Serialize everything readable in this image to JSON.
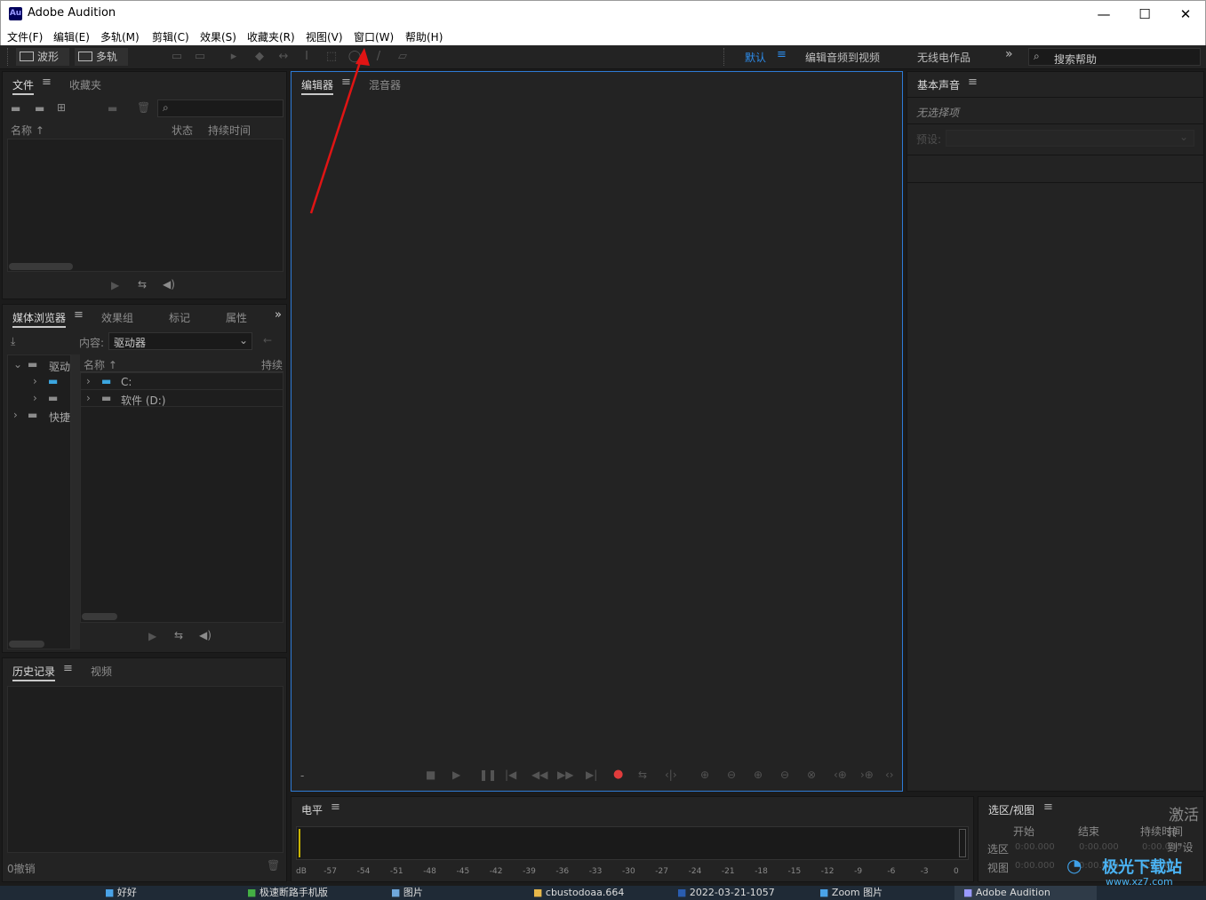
{
  "window": {
    "app_title": "Adobe Audition",
    "logo_text": "Au",
    "minimize": "—",
    "maximize": "☐",
    "close": "✕"
  },
  "menu": [
    {
      "label": "文件(F)"
    },
    {
      "label": "编辑(E)"
    },
    {
      "label": "多轨(M)"
    },
    {
      "label": "剪辑(C)"
    },
    {
      "label": "效果(S)"
    },
    {
      "label": "收藏夹(R)"
    },
    {
      "label": "视图(V)"
    },
    {
      "label": "窗口(W)"
    },
    {
      "label": "帮助(H)"
    }
  ],
  "toolbar": {
    "waveform_label": "波形",
    "multitrack_label": "多轨",
    "workspaces": [
      "默认",
      "编辑音频到视频",
      "无线电作品"
    ],
    "overflow": "»",
    "search_placeholder": "搜索帮助",
    "active_workspace_color": "#2d8ceb"
  },
  "files_panel": {
    "tabs": [
      "文件",
      "收藏夹"
    ],
    "columns": [
      "名称",
      "状态",
      "持续时间"
    ]
  },
  "media_browser": {
    "tabs": [
      "媒体浏览器",
      "效果组",
      "标记",
      "属性"
    ],
    "content_label": "内容:",
    "content_value": "驱动器",
    "tree": [
      {
        "label": "驱动"
      },
      {
        "label": "快捷"
      }
    ],
    "tree_col_header": "名称",
    "col_duration": "持续",
    "items": [
      {
        "label": "C:"
      },
      {
        "label": "软件 (D:)"
      }
    ]
  },
  "history_panel": {
    "tabs": [
      "历史记录",
      "视频"
    ],
    "status": "0撤销"
  },
  "editor": {
    "tabs": [
      "编辑器",
      "混音器"
    ],
    "time_dash": "-",
    "record_color": "#e03c3c",
    "border_color": "#2e7bd6"
  },
  "essential_sound": {
    "title": "基本声音",
    "no_selection": "无选择项",
    "preset_label": "预设:"
  },
  "levels": {
    "title": "电平",
    "scale": [
      "dB",
      "-57",
      "-54",
      "-51",
      "-48",
      "-45",
      "-42",
      "-39",
      "-36",
      "-33",
      "-30",
      "-27",
      "-24",
      "-21",
      "-18",
      "-15",
      "-12",
      "-9",
      "-6",
      "-3",
      "0"
    ]
  },
  "selection_view": {
    "title": "选区/视图",
    "cols": [
      "开始",
      "结束",
      "持续时间"
    ],
    "rows": [
      {
        "label": "选区",
        "start": "0:00.000",
        "end": "0:00.000",
        "duration": "0:00.000"
      },
      {
        "label": "视图",
        "start": "0:00.000",
        "end": "0:00.000",
        "duration": "0:00.000"
      }
    ],
    "activate_text": "激活",
    "activate_sub": "转到\"设"
  },
  "watermark": {
    "text": "极光下载站",
    "url": "www.xz7.com"
  },
  "taskbar": {
    "items": [
      "好好",
      "极速断路手机版",
      "图片",
      "cbustodoaa.664",
      "2022-03-21-1057",
      "Zoom 图片",
      "Adobe Audition"
    ]
  }
}
